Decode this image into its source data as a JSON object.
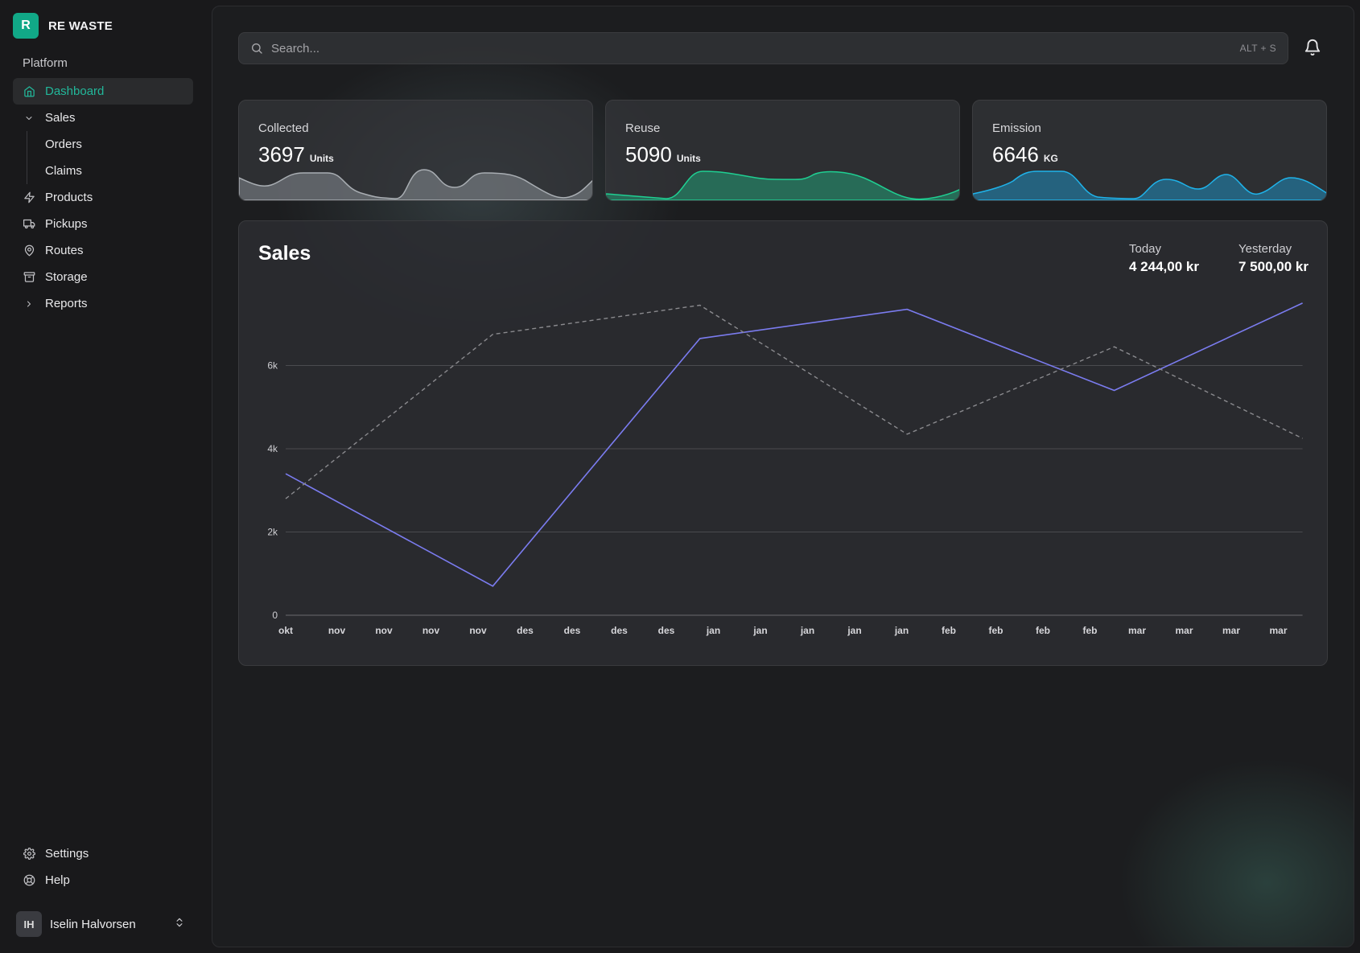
{
  "brand": {
    "logo_letter": "R",
    "name": "RE WASTE",
    "color": "#11a887"
  },
  "sidebar": {
    "section": "Platform",
    "items": [
      {
        "label": "Dashboard",
        "icon": "home-icon",
        "active": true
      },
      {
        "label": "Sales",
        "icon": "chevron-down-icon",
        "expanded": true,
        "children": [
          {
            "label": "Orders"
          },
          {
            "label": "Claims"
          }
        ]
      },
      {
        "label": "Products",
        "icon": "zap-icon"
      },
      {
        "label": "Pickups",
        "icon": "truck-icon"
      },
      {
        "label": "Routes",
        "icon": "map-pin-icon"
      },
      {
        "label": "Storage",
        "icon": "archive-icon"
      },
      {
        "label": "Reports",
        "icon": "chevron-right-icon"
      }
    ],
    "bottom": [
      {
        "label": "Settings",
        "icon": "gear-icon"
      },
      {
        "label": "Help",
        "icon": "lifebuoy-icon"
      }
    ],
    "user": {
      "initials": "IH",
      "name": "Iselin Halvorsen"
    }
  },
  "search": {
    "placeholder": "Search...",
    "shortcut": "ALT + S"
  },
  "cards": [
    {
      "title": "Collected",
      "value": "3697",
      "unit": "Units",
      "color": "#9aa0a6"
    },
    {
      "title": "Reuse",
      "value": "5090",
      "unit": "Units",
      "color": "#1fbf8a"
    },
    {
      "title": "Emission",
      "value": "6646",
      "unit": "KG",
      "color": "#1fa6d6"
    }
  ],
  "sales": {
    "title": "Sales",
    "today_label": "Today",
    "today_value": "4 244,00 kr",
    "yesterday_label": "Yesterday",
    "yesterday_value": "7 500,00 kr"
  },
  "chart_data": {
    "type": "line",
    "x": [
      "okt",
      "nov",
      "nov",
      "nov",
      "nov",
      "des",
      "des",
      "des",
      "des",
      "jan",
      "jan",
      "jan",
      "jan",
      "jan",
      "feb",
      "feb",
      "feb",
      "feb",
      "mar",
      "mar",
      "mar",
      "mar"
    ],
    "yticks": [
      0,
      2000,
      4000,
      6000
    ],
    "ytick_labels": [
      "0",
      "2k",
      "4k",
      "6k"
    ],
    "ylim": [
      0,
      8000
    ],
    "grid": true,
    "series": [
      {
        "style": "solid",
        "color": "#7b7cf0",
        "points": [
          [
            0,
            3400
          ],
          [
            4.4,
            700
          ],
          [
            8.8,
            6650
          ],
          [
            13.2,
            7350
          ],
          [
            17.6,
            5400
          ],
          [
            21.6,
            7500
          ]
        ]
      },
      {
        "style": "dashed",
        "color": "#8a8a8e",
        "points": [
          [
            0,
            2800
          ],
          [
            4.4,
            6750
          ],
          [
            8.8,
            7450
          ],
          [
            13.2,
            4350
          ],
          [
            17.6,
            6450
          ],
          [
            21.6,
            4250
          ]
        ]
      }
    ]
  }
}
